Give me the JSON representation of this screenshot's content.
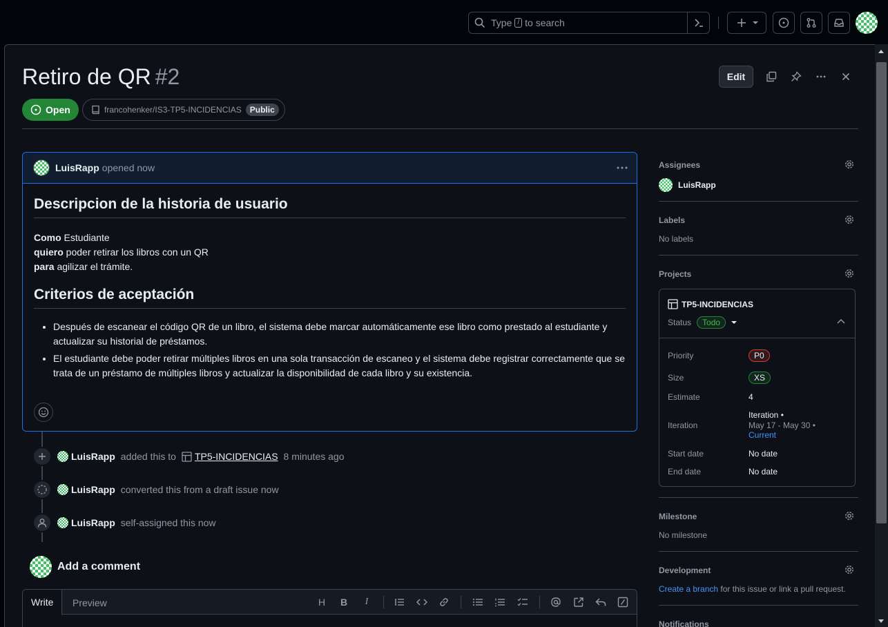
{
  "search": {
    "placeholder_before": "Type",
    "kbd": "/",
    "placeholder_after": "to search"
  },
  "issue": {
    "title": "Retiro de QR",
    "number": "#2",
    "edit_label": "Edit",
    "state": "Open",
    "repo": "francohenker/IS3-TP5-INCIDENCIAS",
    "visibility": "Public"
  },
  "comment": {
    "author": "LuisRapp",
    "action": "opened now",
    "heading1": "Descripcion de la historia de usuario",
    "lines": [
      {
        "kw": "Como",
        "rest": " Estudiante"
      },
      {
        "kw": "quiero",
        "rest": " poder retirar los libros con un QR"
      },
      {
        "kw": "para",
        "rest": " agilizar el trámite."
      }
    ],
    "heading2": "Criterios de aceptación",
    "bullets": [
      "Después de escanear el código QR de un libro, el sistema debe marcar automáticamente ese libro como prestado al estudiante y actualizar su historial de préstamos.",
      "El estudiante debe poder retirar múltiples libros en una sola transacción de escaneo y el sistema debe registrar correctamente que se trata de un préstamo de múltiples libros y actualizar la disponibilidad de cada libro y su existencia."
    ]
  },
  "timeline": [
    {
      "user": "LuisRapp",
      "text": "added this to",
      "project": "TP5-INCIDENCIAS",
      "time": "8 minutes ago"
    },
    {
      "user": "LuisRapp",
      "text": "converted this from a draft issue now"
    },
    {
      "user": "LuisRapp",
      "text": "self-assigned this now"
    }
  ],
  "add_comment": {
    "title": "Add a comment",
    "tab_write": "Write",
    "tab_preview": "Preview",
    "toolbar_heading": "H",
    "toolbar_bold": "B",
    "toolbar_italic": "I"
  },
  "sidebar": {
    "assignees": {
      "label": "Assignees",
      "user": "LuisRapp"
    },
    "labels": {
      "label": "Labels",
      "value": "No labels"
    },
    "projects": {
      "label": "Projects",
      "name": "TP5-INCIDENCIAS",
      "status_label": "Status",
      "status_value": "Todo",
      "fields": {
        "priority_label": "Priority",
        "priority_value": "P0",
        "size_label": "Size",
        "size_value": "XS",
        "estimate_label": "Estimate",
        "estimate_value": "4",
        "iteration_label": "Iteration",
        "iteration_name": "Iteration •",
        "iteration_dates": "May 17 - May 30 •",
        "iteration_current": "Current",
        "start_label": "Start date",
        "start_value": "No date",
        "end_label": "End date",
        "end_value": "No date"
      }
    },
    "milestone": {
      "label": "Milestone",
      "value": "No milestone"
    },
    "development": {
      "label": "Development",
      "link": "Create a branch",
      "rest": " for this issue or link a pull request."
    },
    "notifications": {
      "label": "Notifications"
    }
  },
  "colors": {
    "open_green": "#238636",
    "accent_blue": "#1f6feb",
    "link_blue": "#4493f8",
    "p0_red": "#f85149"
  }
}
